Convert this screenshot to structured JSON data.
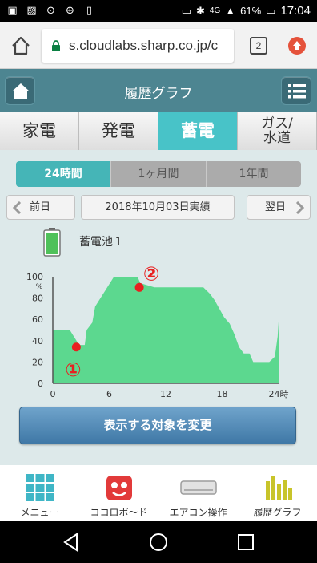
{
  "status_bar": {
    "battery": "61%",
    "time": "17:04",
    "network": "4G"
  },
  "browser": {
    "url": "s.cloudlabs.sharp.co.jp/c",
    "tab_count": "2"
  },
  "app": {
    "title": "履歴グラフ"
  },
  "category_tabs": [
    {
      "label": "家電",
      "active": false
    },
    {
      "label": "発電",
      "active": false
    },
    {
      "label": "蓄電",
      "active": true
    },
    {
      "label": "ガス/\n水道",
      "active": false
    }
  ],
  "period_tabs": [
    {
      "label": "24時間",
      "active": true
    },
    {
      "label": "1ヶ月間",
      "active": false
    },
    {
      "label": "1年間",
      "active": false
    }
  ],
  "date_nav": {
    "prev_label": "前日",
    "date_label": "2018年10月03日実績",
    "next_label": "翌日"
  },
  "device": {
    "name": "蓄電池１"
  },
  "chart_data": {
    "type": "area",
    "title": "",
    "ylabel": "%",
    "xlabel": "",
    "ylim": [
      0,
      100
    ],
    "xlim": [
      0,
      24
    ],
    "x_ticks": [
      "0",
      "6",
      "12",
      "18",
      "24時"
    ],
    "y_ticks": [
      "0",
      "20",
      "40",
      "60",
      "80",
      "100"
    ],
    "color": "#5cd88f",
    "series": [
      {
        "x": [
          0,
          1.8,
          2.3,
          2.8,
          3.4,
          3.6,
          4.2,
          4.5,
          6.5,
          9.0,
          9.3,
          10.8,
          11.8,
          13.5,
          16.0,
          16.7,
          17.2,
          17.7,
          18.2,
          18.8,
          19.3,
          19.8,
          20.3,
          20.9,
          21.3,
          23.0,
          23.6,
          23.9,
          24.0
        ],
        "y": [
          50,
          50,
          43,
          36,
          36,
          50,
          57,
          72,
          100,
          100,
          94,
          90,
          90,
          90,
          90,
          84,
          78,
          70,
          62,
          56,
          46,
          34,
          28,
          28,
          20,
          20,
          25,
          44,
          58
        ]
      }
    ],
    "annotations": [
      {
        "label": "①",
        "x": 2.5,
        "y": 34,
        "color": "#e82020"
      },
      {
        "label": "②",
        "x": 9.2,
        "y": 90,
        "color": "#e82020"
      }
    ]
  },
  "actions": {
    "change_target": "表示する対象を変更"
  },
  "bottom_nav": [
    {
      "label": "メニュー",
      "icon": "grid-menu-icon"
    },
    {
      "label": "ココロボ〜ド",
      "icon": "cocorobo-icon"
    },
    {
      "label": "エアコン操作",
      "icon": "aircon-icon"
    },
    {
      "label": "履歴グラフ",
      "icon": "bar-chart-icon"
    }
  ]
}
